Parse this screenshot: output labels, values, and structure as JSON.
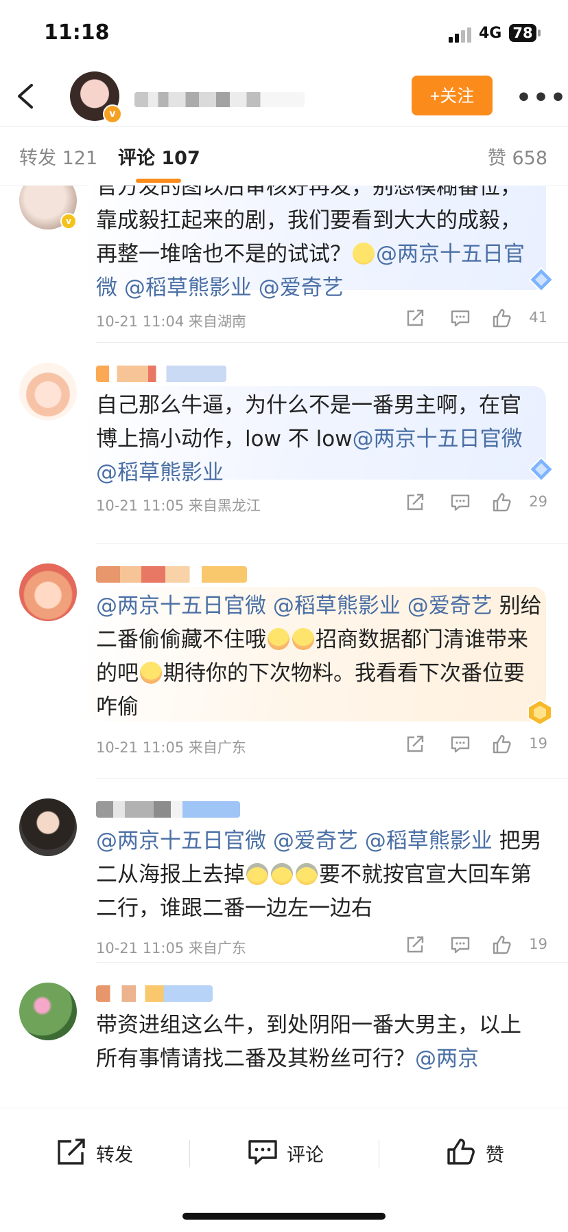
{
  "status_bar": {
    "time": "11:18",
    "network": "4G",
    "battery": "78"
  },
  "nav": {
    "follow_label": "+关注"
  },
  "tabs": {
    "repost": "转发 121",
    "comment": "评论 107",
    "like": "赞 658"
  },
  "colors": {
    "accent": "#fb8c1c",
    "mention": "#4a6fa5",
    "meta": "#999999"
  },
  "comments": [
    {
      "segments": [
        {
          "t": "text",
          "v": "官方发的图以后审核好再发，别想模糊番位，靠成毅扛起来的剧，我们要看到大大的成毅，再整一堆啥也不是的试试？"
        },
        {
          "t": "emoji",
          "v": "smile"
        },
        {
          "t": "at",
          "v": "@两京十五日官微"
        },
        {
          "t": "text",
          "v": " "
        },
        {
          "t": "at",
          "v": "@稻草熊影业"
        },
        {
          "t": "text",
          "v": " "
        },
        {
          "t": "at",
          "v": "@爱奇艺"
        }
      ],
      "meta": "10-21 11:04  来自湖南",
      "likes": "41"
    },
    {
      "segments": [
        {
          "t": "text",
          "v": "自己那么牛逼，为什么不是一番男主啊，在官博上搞小动作，low 不 low"
        },
        {
          "t": "at",
          "v": "@两京十五日官微"
        },
        {
          "t": "text",
          "v": " "
        },
        {
          "t": "at",
          "v": "@稻草熊影业"
        }
      ],
      "meta": "10-21 11:05  来自黑龙江",
      "likes": "29"
    },
    {
      "segments": [
        {
          "t": "at",
          "v": "@两京十五日官微"
        },
        {
          "t": "text",
          "v": " "
        },
        {
          "t": "at",
          "v": "@稻草熊影业"
        },
        {
          "t": "text",
          "v": " "
        },
        {
          "t": "at",
          "v": "@爱奇艺"
        },
        {
          "t": "text",
          "v": " 别给二番偷偷藏不住哦"
        },
        {
          "t": "emoji",
          "v": "shy"
        },
        {
          "t": "emoji",
          "v": "shy"
        },
        {
          "t": "text",
          "v": "招商数据都门清谁带来的吧"
        },
        {
          "t": "emoji",
          "v": "shy"
        },
        {
          "t": "text",
          "v": "期待你的下次物料。我看看下次番位要咋偷"
        }
      ],
      "meta": "10-21 11:05  来自广东",
      "likes": "19"
    },
    {
      "segments": [
        {
          "t": "at",
          "v": "@两京十五日官微"
        },
        {
          "t": "text",
          "v": " "
        },
        {
          "t": "at",
          "v": "@爱奇艺"
        },
        {
          "t": "text",
          "v": " "
        },
        {
          "t": "at",
          "v": "@稻草熊影业"
        },
        {
          "t": "text",
          "v": " 把男二从海报上去掉"
        },
        {
          "t": "emoji",
          "v": "scared"
        },
        {
          "t": "emoji",
          "v": "scared"
        },
        {
          "t": "emoji",
          "v": "scared"
        },
        {
          "t": "text",
          "v": "要不就按官宣大回车第二行，谁跟二番一边左一边右"
        }
      ],
      "meta": "10-21 11:05  来自广东",
      "likes": "19"
    },
    {
      "segments": [
        {
          "t": "text",
          "v": "带资进组这么牛，到处阴阳一番大男主，以上所有事情请找二番及其粉丝可行？"
        },
        {
          "t": "at",
          "v": "@两京"
        }
      ],
      "meta": "",
      "likes": ""
    }
  ],
  "bottom_bar": {
    "repost": "转发",
    "comment": "评论",
    "like": "赞"
  }
}
